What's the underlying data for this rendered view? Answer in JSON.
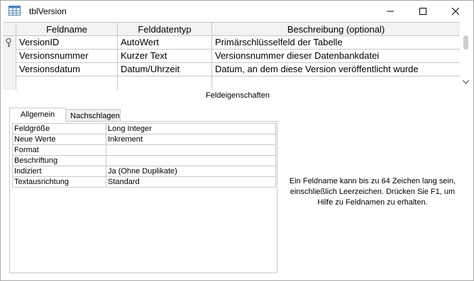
{
  "window": {
    "title": "tblVersion",
    "icon": "table-icon"
  },
  "grid": {
    "columns": [
      "Feldname",
      "Felddatentyp",
      "Beschreibung (optional)"
    ],
    "rows": [
      {
        "name": "VersionID",
        "type": "AutoWert",
        "description": "Primärschlüsselfeld der Tabelle",
        "primary_key": true
      },
      {
        "name": "Versionsnummer",
        "type": "Kurzer Text",
        "description": "Versionsnummer dieser Datenbankdatei",
        "primary_key": false
      },
      {
        "name": "Versionsdatum",
        "type": "Datum/Uhrzeit",
        "description": "Datum, an dem diese Version veröffentlicht wurde",
        "primary_key": false
      },
      {
        "name": "",
        "type": "",
        "description": "",
        "primary_key": false
      }
    ]
  },
  "section_label": "Feldeigenschaften",
  "tabs": [
    "Allgemein",
    "Nachschlagen"
  ],
  "properties": [
    {
      "label": "Feldgröße",
      "value": "Long Integer"
    },
    {
      "label": "Neue Werte",
      "value": "Inkrement"
    },
    {
      "label": "Format",
      "value": ""
    },
    {
      "label": "Beschriftung",
      "value": ""
    },
    {
      "label": "Indiziert",
      "value": "Ja (Ohne Duplikate)"
    },
    {
      "label": "Textausrichtung",
      "value": "Standard"
    }
  ],
  "help_text": "Ein Feldname kann bis zu 64 Zeichen lang sein, einschließlich Leerzeichen. Drücken Sie F1, um Hilfe zu Feldnamen zu erhalten."
}
